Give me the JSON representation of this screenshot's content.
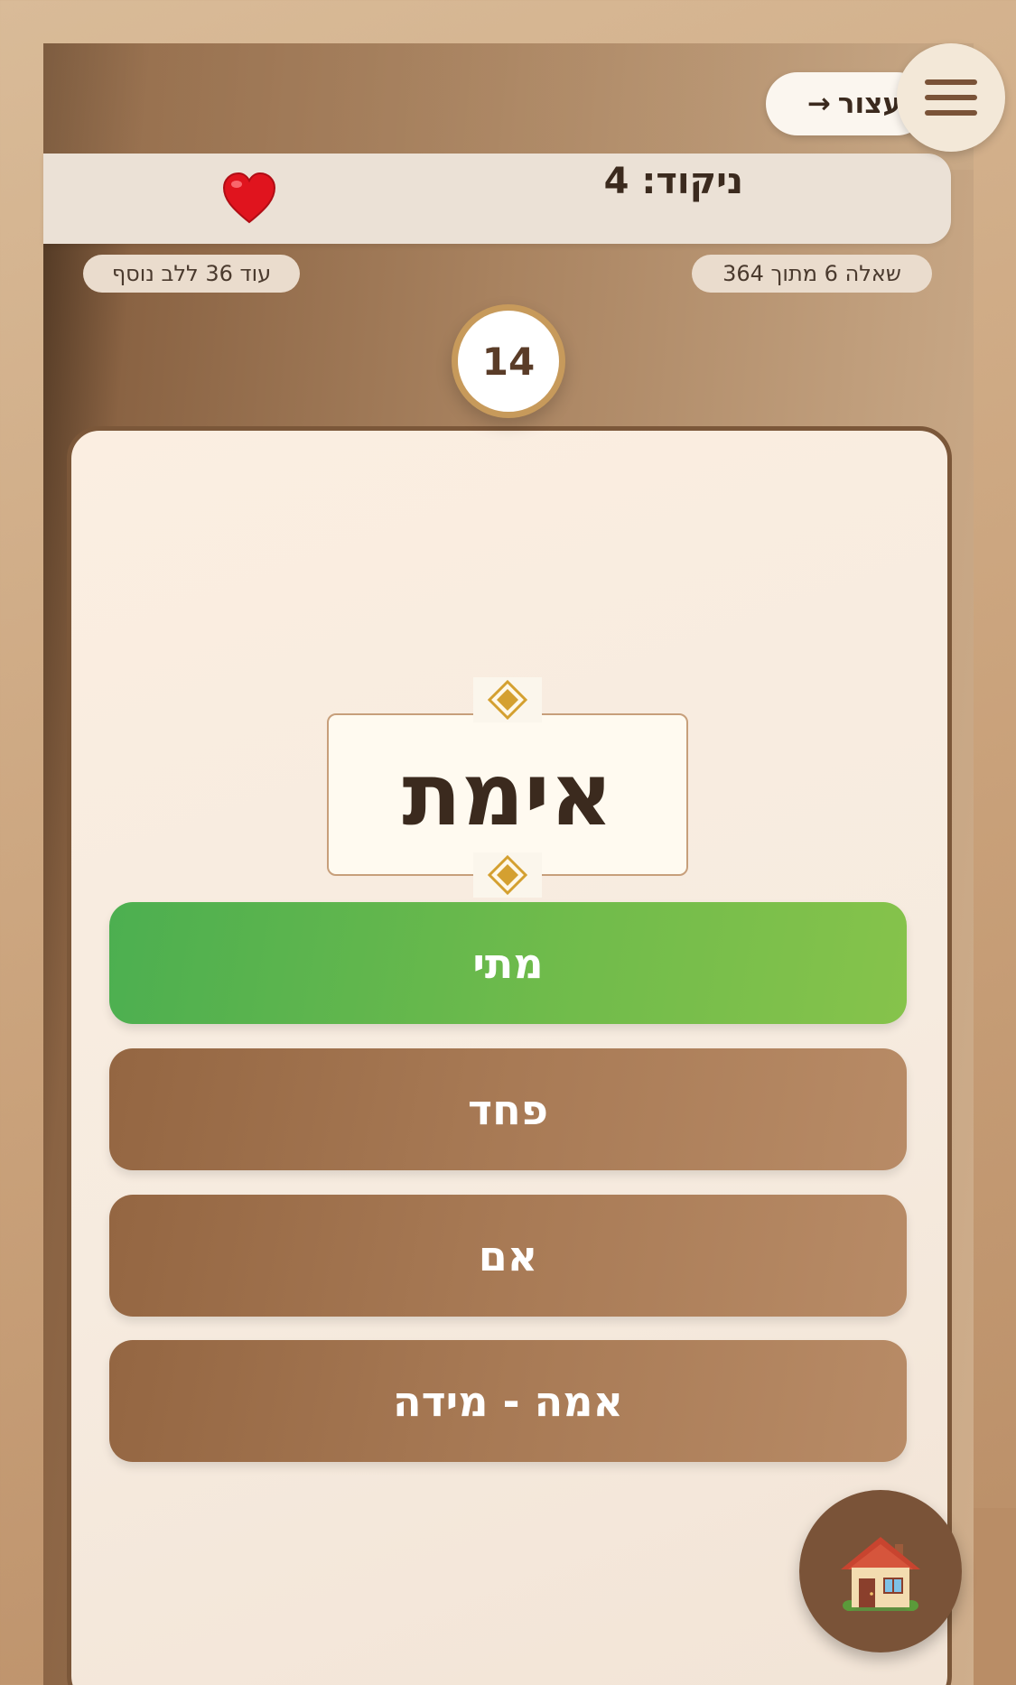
{
  "header": {
    "pause_label": "עצור",
    "pause_arrow": "→"
  },
  "score_bar": {
    "score_text": "ניקוד: 4",
    "lives": 1
  },
  "progress": {
    "question_counter": "שאלה 6 מתוך 364",
    "next_life_text": "עוד 36 ללב נוסף"
  },
  "timer": {
    "seconds": "14"
  },
  "question": {
    "word": "אימת"
  },
  "answers": [
    {
      "label": "מתי",
      "state": "correct"
    },
    {
      "label": "פחד",
      "state": "default"
    },
    {
      "label": "אם",
      "state": "default"
    },
    {
      "label": "אמה - מידה",
      "state": "default"
    }
  ],
  "icons": {
    "menu": "hamburger-icon",
    "heart": "heart-icon",
    "home": "house-icon",
    "ornament": "diamond-icon"
  },
  "colors": {
    "correct_green": "#4caf50",
    "answer_brown": "#a87a55",
    "timer_ring": "#c79a5b",
    "diamond_gold": "#d4a030"
  }
}
